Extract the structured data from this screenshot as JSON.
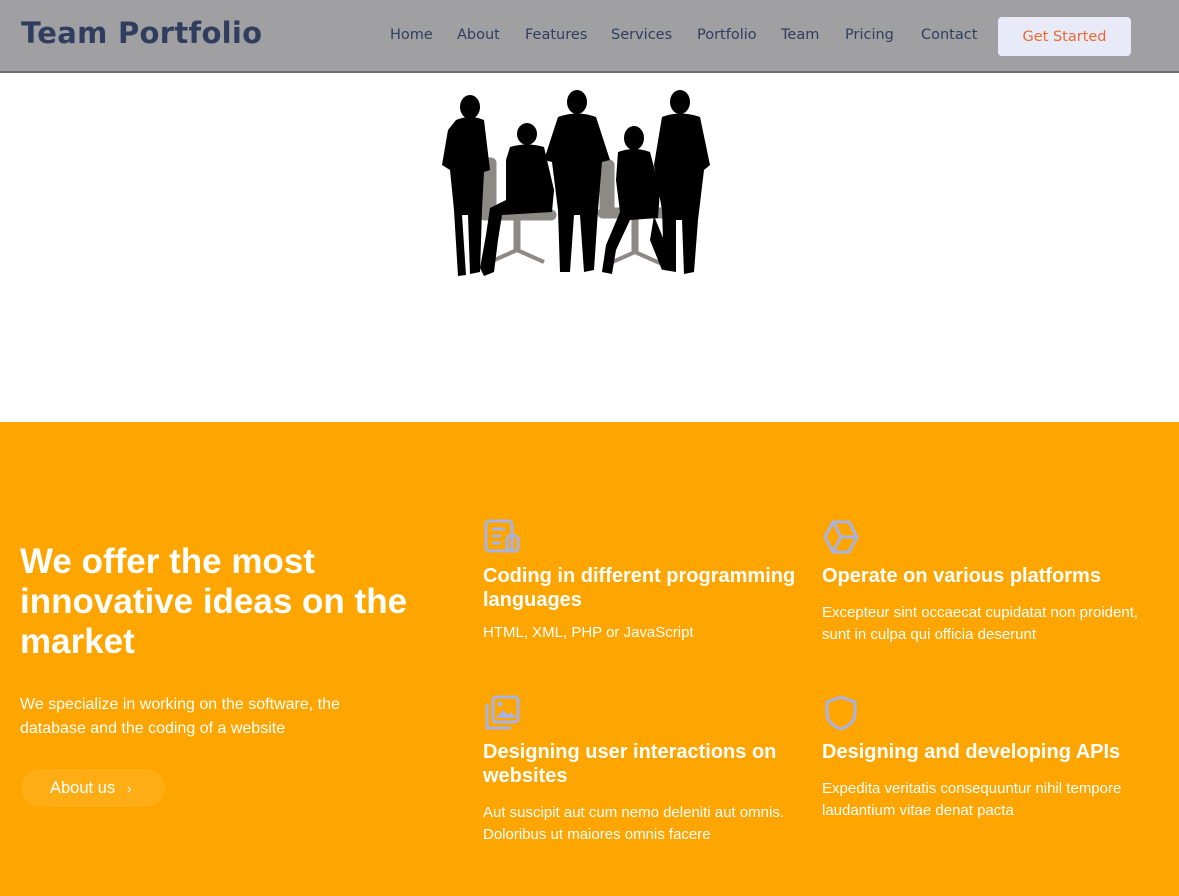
{
  "header": {
    "logo": "Team Portfolio",
    "nav": [
      "Home",
      "About",
      "Features",
      "Services",
      "Portfolio",
      "Team",
      "Pricing",
      "Contact"
    ],
    "cta_label": "Get Started"
  },
  "colors": {
    "header_bg": "#a09fa1",
    "brand_text": "#2f3e5e",
    "accent": "#ffa500",
    "cta_text": "#e96a33",
    "icon": "#a7b3e6"
  },
  "hero": {
    "image": "team-silhouette-image"
  },
  "offer": {
    "title": "We offer the most innovative ideas on the market",
    "description": "We specialize in working on the software, the database and the coding of a website",
    "button_label": "About us",
    "features": [
      {
        "icon": "document-icon",
        "title": "Coding in different programming languages",
        "description": "HTML, XML, PHP or JavaScript"
      },
      {
        "icon": "cube-icon",
        "title": "Operate on various platforms",
        "description": "Excepteur sint occaecat cupidatat non proident, sunt in culpa qui officia deserunt"
      },
      {
        "icon": "images-icon",
        "title": "Designing user interactions on websites",
        "description": "Aut suscipit aut cum nemo deleniti aut omnis. Doloribus ut maiores omnis facere"
      },
      {
        "icon": "shield-icon",
        "title": "Designing and developing APIs",
        "description": "Expedita veritatis consequuntur nihil tempore laudantium vitae denat pacta"
      }
    ]
  }
}
